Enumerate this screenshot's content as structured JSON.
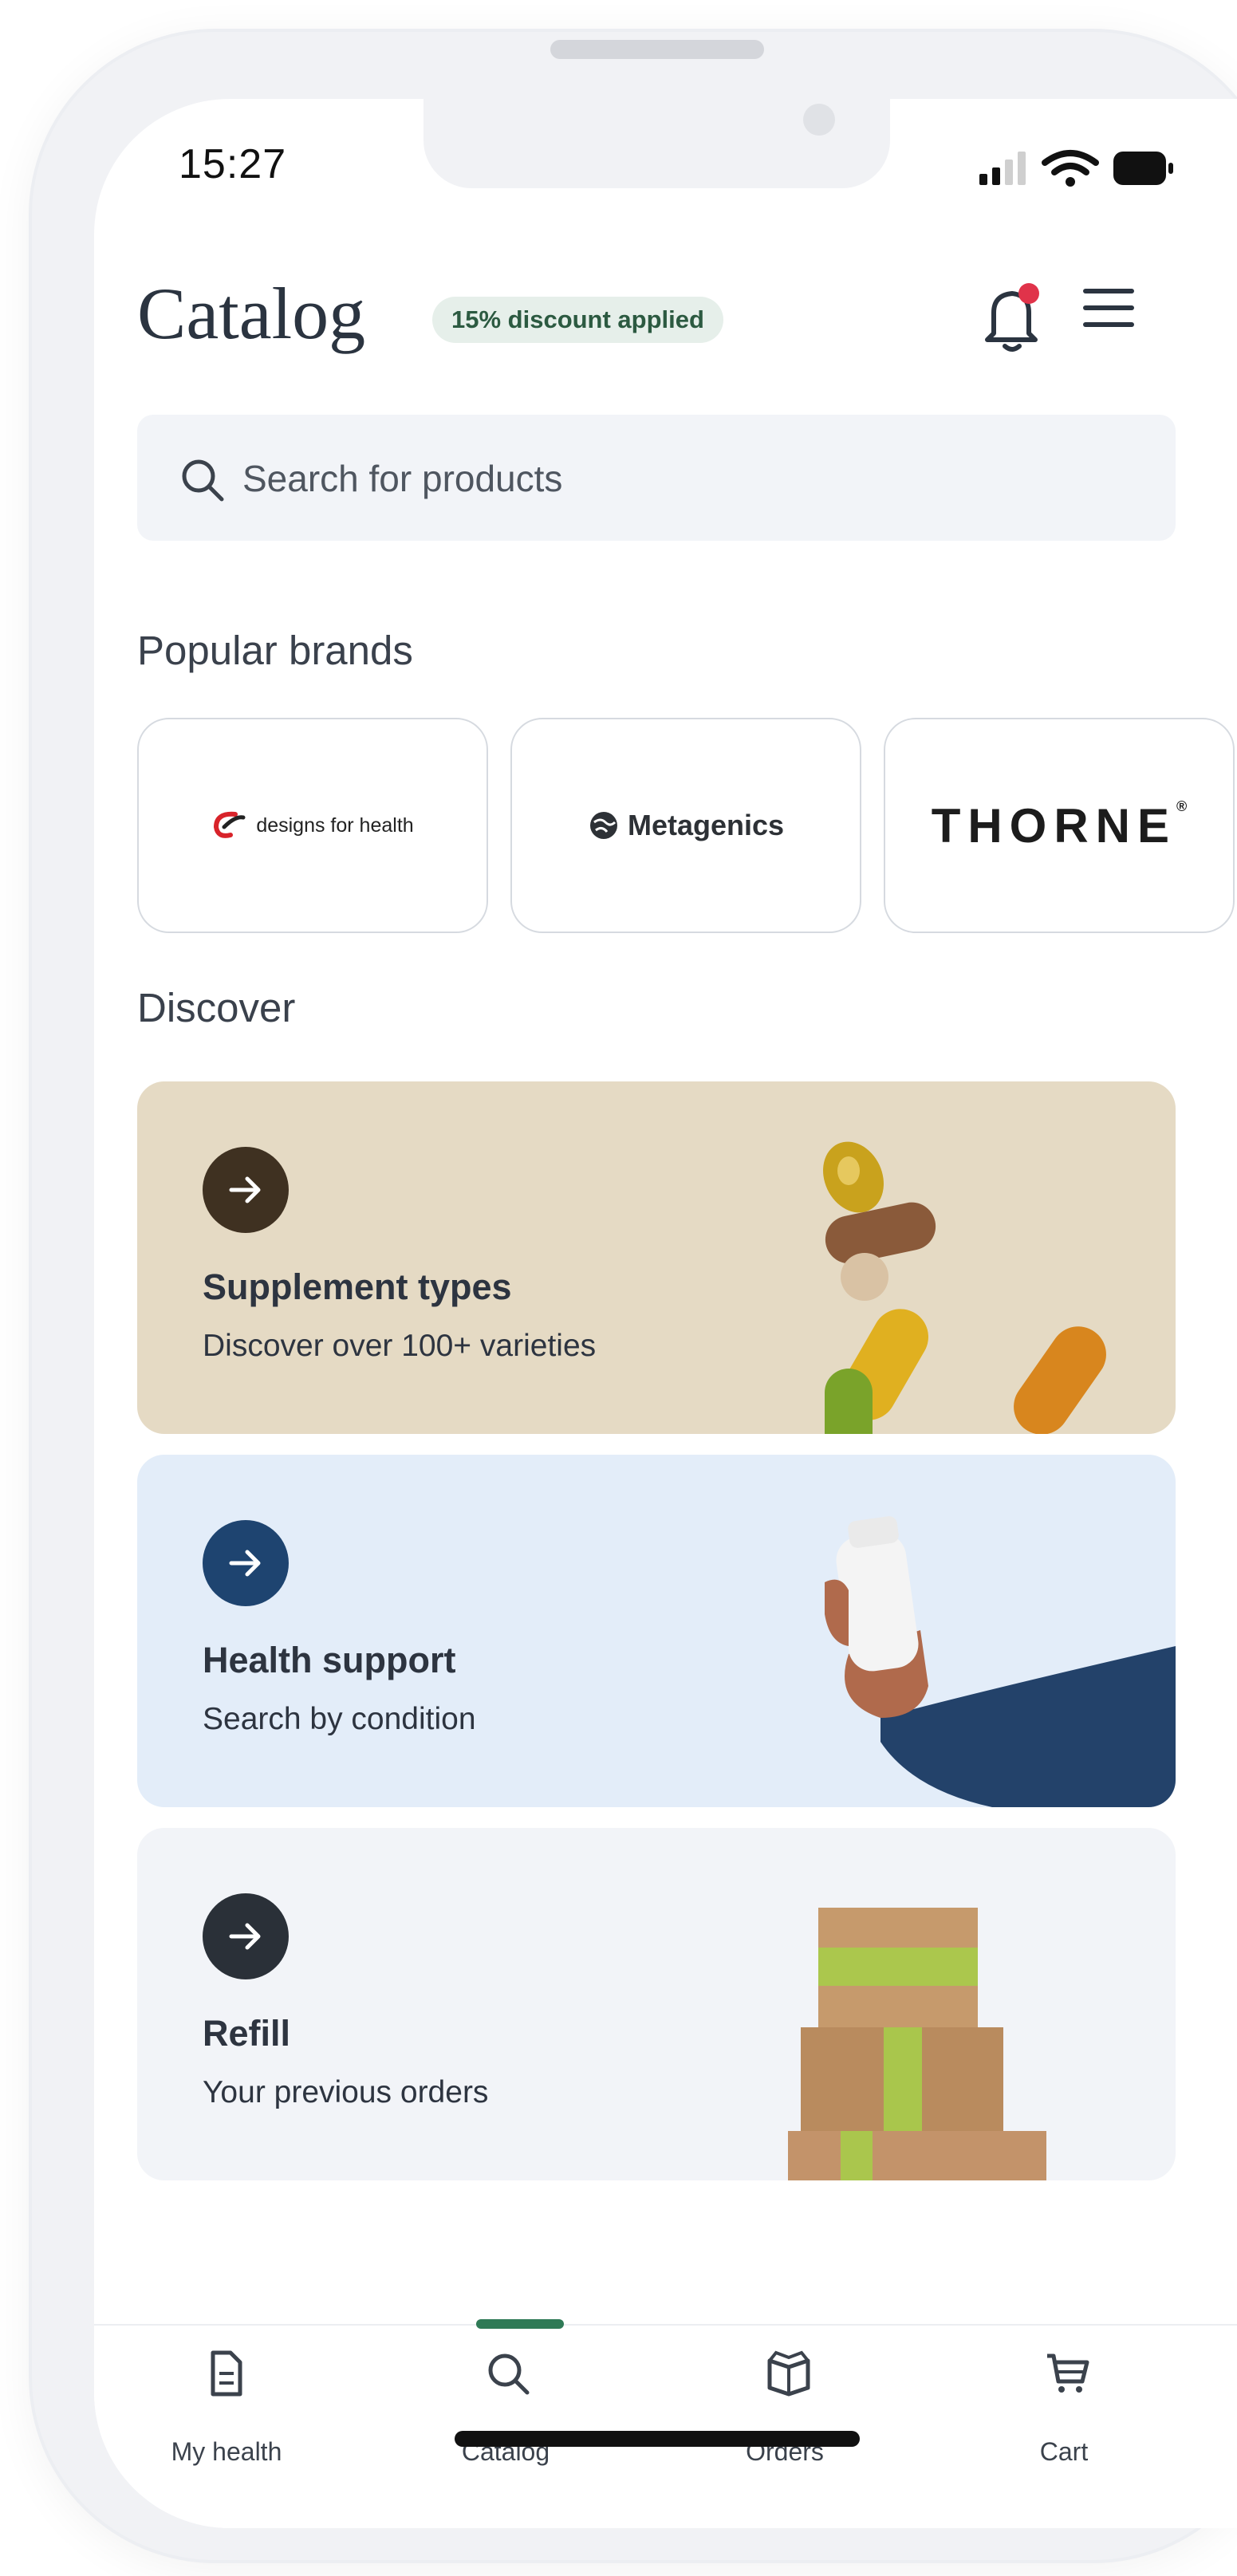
{
  "status_bar": {
    "time": "15:27"
  },
  "header": {
    "title": "Catalog",
    "discount_badge": "15% discount applied"
  },
  "search": {
    "placeholder": "Search for products"
  },
  "popular_brands": {
    "title": "Popular brands",
    "items": [
      {
        "label": "designs for health",
        "icon": "dfh-logo-icon"
      },
      {
        "label": "Metagenics",
        "icon": "metagenics-globe-icon"
      },
      {
        "label": "THORNE",
        "icon": ""
      }
    ]
  },
  "discover": {
    "title": "Discover",
    "cards": [
      {
        "title": "Supplement types",
        "subtitle": "Discover over 100+ varieties",
        "bg": "#e5dac4",
        "arrow_bg": "#3f3121"
      },
      {
        "title": "Health support",
        "subtitle": "Search by condition",
        "bg": "#e3edf9",
        "arrow_bg": "#1e4470"
      },
      {
        "title": "Refill",
        "subtitle": "Your previous orders",
        "bg": "#f2f4f8",
        "arrow_bg": "#2a3038"
      }
    ]
  },
  "nav": {
    "items": [
      {
        "label": "My health",
        "icon": "document-icon"
      },
      {
        "label": "Catalog",
        "icon": "search-icon",
        "active": true
      },
      {
        "label": "Orders",
        "icon": "box-icon"
      },
      {
        "label": "Cart",
        "icon": "cart-icon"
      }
    ],
    "accent": "#2f7a56"
  }
}
